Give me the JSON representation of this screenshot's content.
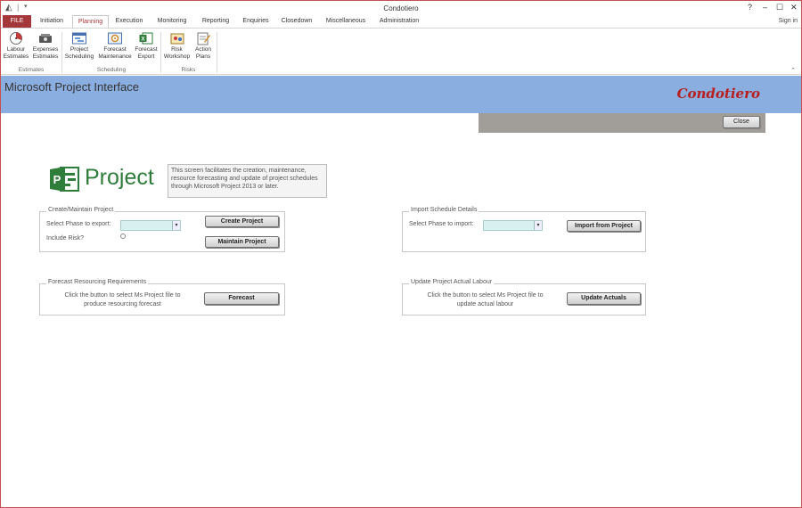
{
  "window": {
    "title": "Condotiero",
    "controls": [
      "?",
      "–",
      "☐",
      "✕"
    ],
    "sign_in": "Sign in"
  },
  "tabs": [
    {
      "label": "FILE"
    },
    {
      "label": "Initiation"
    },
    {
      "label": "Planning"
    },
    {
      "label": "Execution"
    },
    {
      "label": "Monitoring"
    },
    {
      "label": "Reporting"
    },
    {
      "label": "Enquiries"
    },
    {
      "label": "Closedown"
    },
    {
      "label": "Miscellaneous"
    },
    {
      "label": "Administration"
    }
  ],
  "active_tab": "Planning",
  "ribbon": {
    "buttons": [
      {
        "line1": "Labour",
        "line2": "Estimates",
        "icon": "labour-estimates-icon"
      },
      {
        "line1": "Expenses",
        "line2": "Estimates",
        "icon": "expenses-estimates-icon"
      },
      {
        "line1": "Project",
        "line2": "Scheduling",
        "icon": "project-scheduling-icon"
      },
      {
        "line1": "Forecast",
        "line2": "Maintenance",
        "icon": "forecast-maintenance-icon"
      },
      {
        "line1": "Forecast",
        "line2": "Export",
        "icon": "forecast-export-icon"
      },
      {
        "line1": "Risk",
        "line2": "Workshop",
        "icon": "risk-workshop-icon"
      },
      {
        "line1": "Action",
        "line2": "Plans",
        "icon": "action-plans-icon"
      }
    ],
    "groups": [
      "Estimates",
      "Scheduling",
      "Risks"
    ]
  },
  "header": {
    "title": "Microsoft Project Interface",
    "brand": "Condotiero"
  },
  "close_button": "Close",
  "logo": {
    "word": "Project",
    "initial": "P"
  },
  "description": "This screen facilitates the creation, maintenance, resource forecasting and update of project schedules through Microsoft Project 2013 or later.",
  "create_maintain": {
    "title": "Create/Maintain Project",
    "phase_label": "Select Phase to export:",
    "phase_value": "",
    "risk_label": "Include Risk?",
    "create_button": "Create Project",
    "maintain_button": "Maintain Project"
  },
  "import_schedule": {
    "title": "Import Schedule Details",
    "phase_label": "Select Phase to import:",
    "phase_value": "",
    "import_button": "Import from Project"
  },
  "forecast": {
    "title": "Forecast Resourcing Requirements",
    "line1": "Click the button to select Ms Project file to",
    "line2": "produce resourcing forecast",
    "button": "Forecast"
  },
  "actuals": {
    "title": "Update Project Actual Labour",
    "line1": "Click the button to select Ms Project file to",
    "line2": "update actual labour",
    "button": "Update Actuals"
  },
  "colors": {
    "file_tab": "#a4373a",
    "header_band": "#8aaedf",
    "brand_text": "#b81e1e",
    "project_green": "#2f7d3b",
    "combo_fill": "#d8f0f0",
    "close_strip": "#a19e9a"
  }
}
